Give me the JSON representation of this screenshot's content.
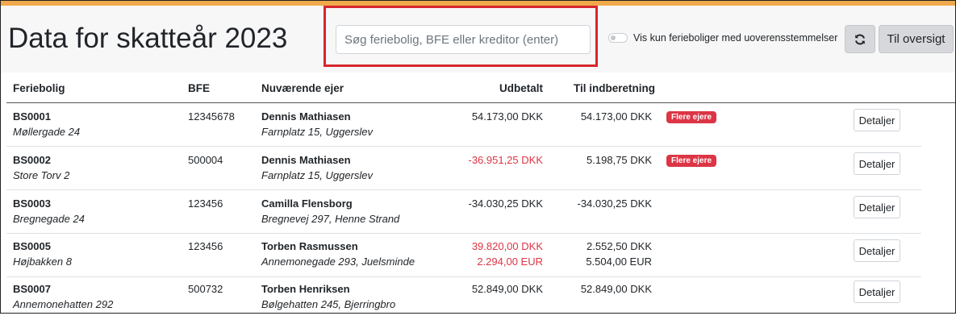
{
  "header": {
    "title": "Data for skatteår 2023",
    "search_placeholder": "Søg feriebolig, BFE eller kreditor (enter)",
    "toggle_label": "Vis kun ferieboliger med uoverensstemmelser",
    "refresh_icon": "refresh-icon",
    "overview_label": "Til oversigt"
  },
  "colors": {
    "accent_bar": "#f0a94a",
    "highlight": "#d7262d",
    "negative": "#dc3545",
    "badge": "#dc3545"
  },
  "table": {
    "headers": {
      "feriebolig": "Feriebolig",
      "bfe": "BFE",
      "owner": "Nuværende ejer",
      "paid": "Udbetalt",
      "report": "Til indberetning"
    },
    "rows": [
      {
        "id": "BS0001",
        "address": "Møllergade 24",
        "bfe": "12345678",
        "owner": "Dennis Mathiasen",
        "owner_address": "Farnplatz 15, Uggerslev",
        "paid": [
          "54.173,00 DKK"
        ],
        "report": [
          "54.173,00 DKK"
        ],
        "badge": "Flere ejere",
        "details": "Detaljer"
      },
      {
        "id": "BS0002",
        "address": "Store Torv 2",
        "bfe": "500004",
        "owner": "Dennis Mathiasen",
        "owner_address": "Farnplatz 15, Uggerslev",
        "paid": [
          "-36.951,25 DKK"
        ],
        "report": [
          "5.198,75 DKK"
        ],
        "badge": "Flere ejere",
        "details": "Detaljer"
      },
      {
        "id": "BS0003",
        "address": "Bregnegade 24",
        "bfe": "123456",
        "owner": "Camilla Flensborg",
        "owner_address": "Bregnevej 297, Henne Strand",
        "paid": [
          "-34.030,25 DKK"
        ],
        "report": [
          "-34.030,25 DKK"
        ],
        "badge": "",
        "details": "Detaljer"
      },
      {
        "id": "BS0005",
        "address": "Højbakken 8",
        "bfe": "123456",
        "owner": "Torben Rasmussen",
        "owner_address": "Annemonegade 293, Juelsminde",
        "paid": [
          "39.820,00 DKK",
          "2.294,00 EUR"
        ],
        "report": [
          "2.552,50 DKK",
          "5.504,00 EUR"
        ],
        "badge": "",
        "details": "Detaljer"
      },
      {
        "id": "BS0007",
        "address": "Annemonehatten 292",
        "bfe": "500732",
        "owner": "Torben Henriksen",
        "owner_address": "Bølgehatten 245, Bjerringbro",
        "paid": [
          "52.849,00 DKK"
        ],
        "report": [
          "52.849,00 DKK"
        ],
        "badge": "",
        "details": "Detaljer"
      }
    ]
  }
}
